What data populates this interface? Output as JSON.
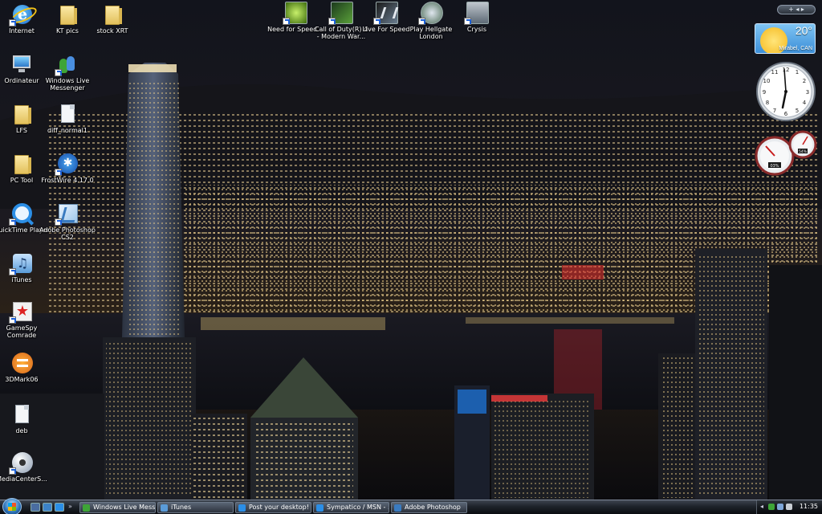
{
  "desktop_icons": [
    {
      "label": "Internet",
      "icon": "internet-explorer-icon"
    },
    {
      "label": "KT pics",
      "icon": "folder-icon"
    },
    {
      "label": "stock XRT",
      "icon": "folder-icon"
    },
    {
      "label": "Ordinateur",
      "icon": "computer-icon"
    },
    {
      "label": "Windows Live Messenger",
      "icon": "messenger-icon"
    },
    {
      "label": "LFS",
      "icon": "folder-icon"
    },
    {
      "label": "diff_normal1",
      "icon": "image-file-icon"
    },
    {
      "label": "PC Tool",
      "icon": "folder-icon"
    },
    {
      "label": "FrostWire 4.17.0",
      "icon": "frostwire-icon"
    },
    {
      "label": "QuickTime Player",
      "icon": "quicktime-icon"
    },
    {
      "label": "Adobe Photoshop CS2",
      "icon": "photoshop-icon"
    },
    {
      "label": "iTunes",
      "icon": "itunes-icon"
    },
    {
      "label": "GameSpy Comrade",
      "icon": "gamespy-icon"
    },
    {
      "label": "3DMark06",
      "icon": "3dmark-icon"
    },
    {
      "label": "deb",
      "icon": "file-icon"
    },
    {
      "label": "MediaCenterS...",
      "icon": "media-center-icon"
    }
  ],
  "game_icons": [
    {
      "label": "Need for Speed...",
      "icon": "need-for-speed-icon"
    },
    {
      "label": "Call of Duty(R) 4 - Modern War...",
      "icon": "call-of-duty-icon"
    },
    {
      "label": "Live For Speed",
      "icon": "live-for-speed-icon"
    },
    {
      "label": "Play Hellgate London",
      "icon": "hellgate-icon"
    },
    {
      "label": "Crysis",
      "icon": "crysis-icon"
    }
  ],
  "gadgets": {
    "controls": "+ ◂ ▸",
    "weather": {
      "temperature": "20°",
      "city": "Mirabel, CAN"
    },
    "cpu_meter": {
      "cpu_label": "03%",
      "ram_label": "54%"
    }
  },
  "taskbar": {
    "buttons": [
      {
        "label": "Windows Live Mess...",
        "icon": "messenger-icon",
        "color": "#3ea437"
      },
      {
        "label": "iTunes",
        "icon": "itunes-icon",
        "color": "#5a9bd8"
      },
      {
        "label": "Post your desktop! -...",
        "icon": "browser-icon",
        "color": "#2b8ee6"
      },
      {
        "label": "Sympatico / MSN - ...",
        "icon": "browser-icon",
        "color": "#2b8ee6"
      },
      {
        "label": "Adobe Photoshop",
        "icon": "photoshop-icon",
        "color": "#3a7bc0"
      }
    ],
    "clock": "11:35"
  },
  "colors": {
    "taskbar_top": "#3d4450",
    "taskbar_bottom": "#0b0d11",
    "accent": "#2a6fb6"
  }
}
